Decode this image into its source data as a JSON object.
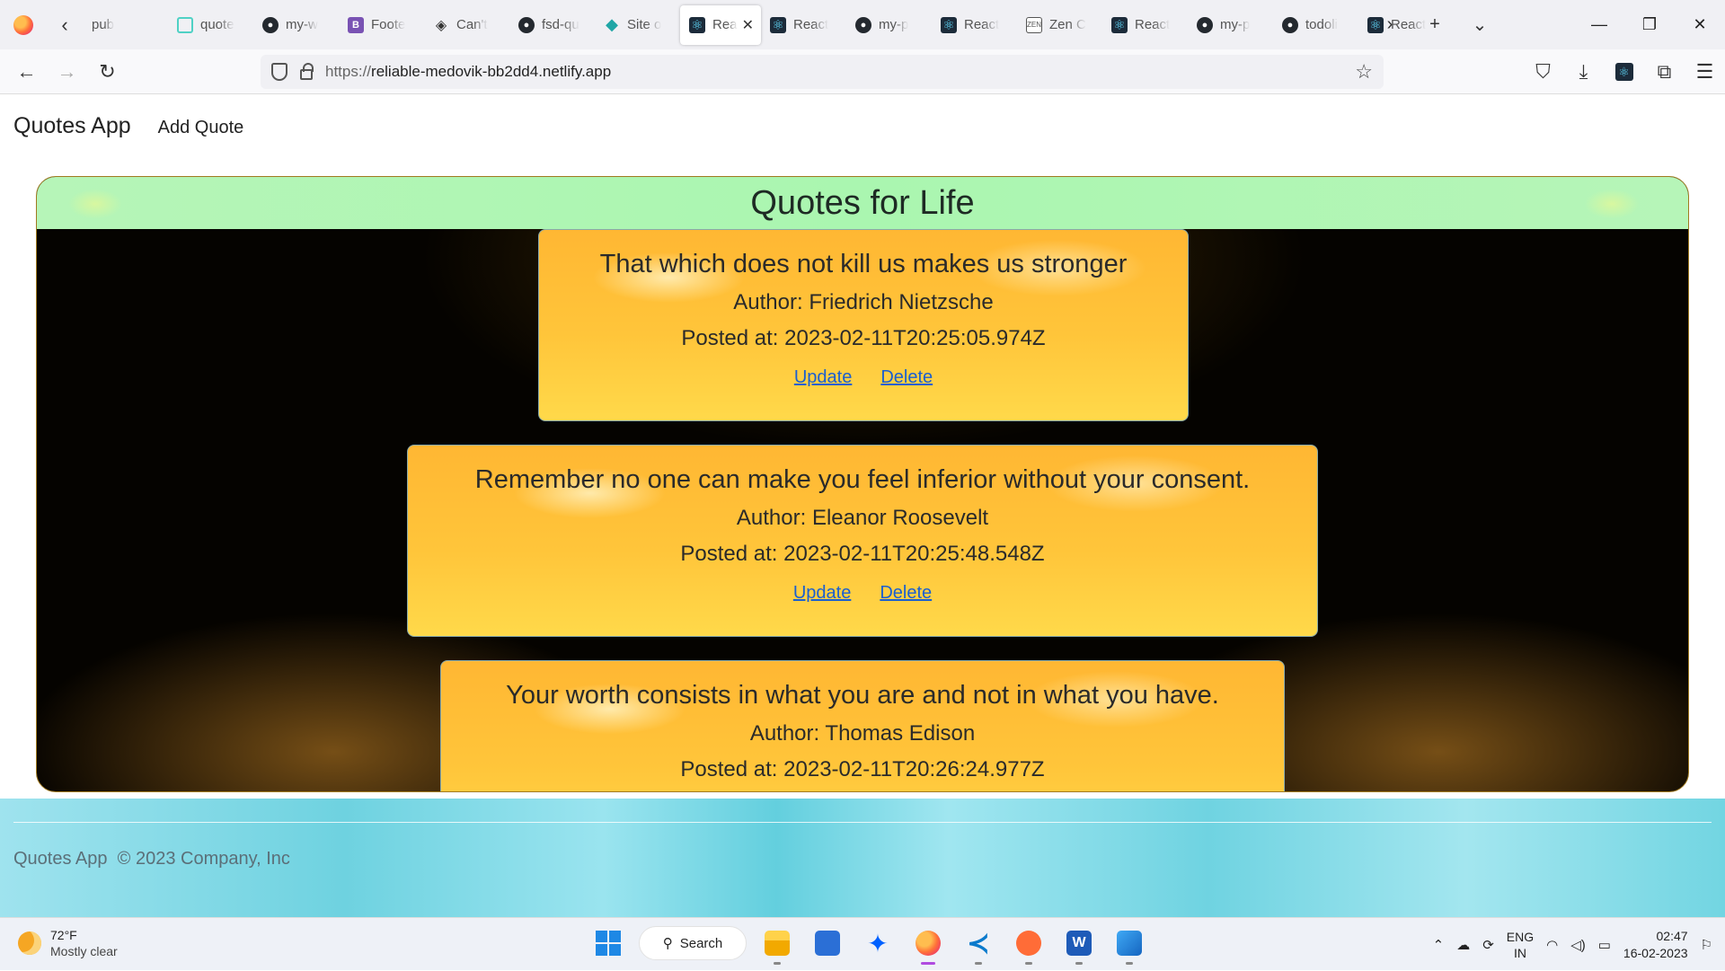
{
  "browser": {
    "tabs": [
      {
        "label": "pub",
        "icon": "scroll-left-partial-icon"
      },
      {
        "label": "quote",
        "icon": "quote-page-icon"
      },
      {
        "label": "my-w",
        "icon": "github-icon"
      },
      {
        "label": "Foote",
        "icon": "bootstrap-icon"
      },
      {
        "label": "Can't",
        "icon": "diamond-icon"
      },
      {
        "label": "fsd-qu",
        "icon": "github-icon"
      },
      {
        "label": "Site o",
        "icon": "netlify-icon"
      },
      {
        "label": "Rea",
        "icon": "react-icon",
        "active": true
      },
      {
        "label": "React",
        "icon": "react-icon"
      },
      {
        "label": "my-p",
        "icon": "github-icon"
      },
      {
        "label": "React",
        "icon": "react-icon"
      },
      {
        "label": "Zen C",
        "icon": "zen-icon"
      },
      {
        "label": "React",
        "icon": "react-icon"
      },
      {
        "label": "my-p",
        "icon": "github-icon"
      },
      {
        "label": "todoli",
        "icon": "github-icon"
      },
      {
        "label": "React",
        "icon": "react-icon"
      }
    ],
    "url_protocol": "https://",
    "url_host": "reliable-medovik-bb2dd4.netlify.app"
  },
  "app": {
    "brand": "Quotes App",
    "nav_add": "Add Quote",
    "section_title": "Quotes for Life",
    "update_label": "Update",
    "delete_label": "Delete",
    "quotes": [
      {
        "text": "That which does not kill us makes us stronger",
        "author": "Author: Friedrich Nietzsche",
        "posted": "Posted at: 2023-02-11T20:25:05.974Z"
      },
      {
        "text": "Remember no one can make you feel inferior without your consent.",
        "author": "Author: Eleanor Roosevelt",
        "posted": "Posted at: 2023-02-11T20:25:48.548Z"
      },
      {
        "text": "Your worth consists in what you are and not in what you have.",
        "author": "Author: Thomas Edison",
        "posted": "Posted at: 2023-02-11T20:26:24.977Z"
      }
    ],
    "footer_brand": "Quotes App",
    "footer_copy": "© 2023 Company, Inc"
  },
  "taskbar": {
    "temp": "72°F",
    "weather": "Mostly clear",
    "search": "Search",
    "lang1": "ENG",
    "lang2": "IN",
    "time": "02:47",
    "date": "16-02-2023"
  }
}
